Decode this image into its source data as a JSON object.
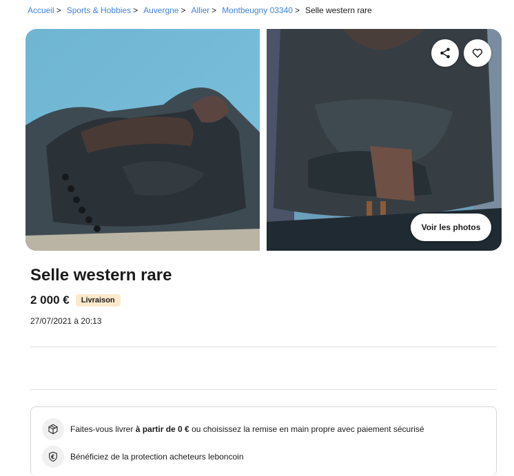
{
  "breadcrumb": {
    "items": [
      {
        "label": "Accueil"
      },
      {
        "label": "Sports & Hobbies"
      },
      {
        "label": "Auvergne"
      },
      {
        "label": "Allier"
      },
      {
        "label": "Montbeugny 03340"
      }
    ],
    "separator": ">",
    "current": "Selle western rare"
  },
  "gallery": {
    "photos_button_label": "Voir les photos",
    "share_icon": "share-icon",
    "favorite_icon": "heart-icon"
  },
  "listing": {
    "title": "Selle western rare",
    "price": "2 000 €",
    "badge": "Livraison",
    "date": "27/07/2021 à 20:13"
  },
  "info": {
    "delivery_prefix": "Faites-vous livrer ",
    "delivery_bold": "à partir de 0 €",
    "delivery_suffix": " ou choisissez la remise en main propre avec paiement sécurisé",
    "protection": "Bénéficiez de la protection acheteurs leboncoin"
  },
  "colors": {
    "link": "#4183d7",
    "badge_bg": "#fbe9cc"
  }
}
